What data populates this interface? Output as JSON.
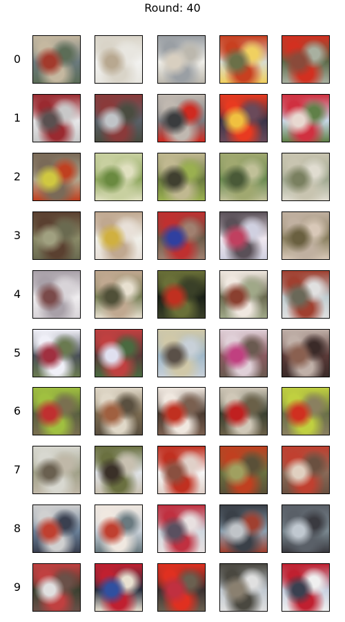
{
  "title": "Round: 40",
  "rows": [
    {
      "label": "0",
      "images": [
        [
          "#6b7a7e",
          "#c5b8a0",
          "#a33a2c",
          "#5c6d57"
        ],
        [
          "#f2f2f0",
          "#d9d4c8",
          "#b8a890",
          "#e8e6e0"
        ],
        [
          "#f0efea",
          "#9a9fa4",
          "#d8cfc0",
          "#bcb8ae"
        ],
        [
          "#d8dcd2",
          "#c84020",
          "#6b7048",
          "#f0d060"
        ],
        [
          "#5d6a4a",
          "#d23020",
          "#8a4a3a",
          "#a8b0a0"
        ]
      ]
    },
    {
      "label": "1",
      "images": [
        [
          "#e8e8ea",
          "#9a2a30",
          "#5a5050",
          "#c8c8c8"
        ],
        [
          "#5a6068",
          "#8a3a3a",
          "#c0c4c8",
          "#4a4c40"
        ],
        [
          "#7a7c80",
          "#c0b8b0",
          "#3a3c3e",
          "#d02a20"
        ],
        [
          "#3a3448",
          "#e83a20",
          "#f0c040",
          "#6a4a5a"
        ],
        [
          "#c8d8e8",
          "#d03040",
          "#e8d8d0",
          "#608048"
        ]
      ]
    },
    {
      "label": "2",
      "images": [
        [
          "#b0a890",
          "#7a6a58",
          "#d0c840",
          "#c04020"
        ],
        [
          "#90a860",
          "#c8d0a0",
          "#6a8a40",
          "#e0e0c0"
        ],
        [
          "#6a7a40",
          "#c0b890",
          "#404030",
          "#9ab050"
        ],
        [
          "#6a8a50",
          "#a0a870",
          "#4a5a38",
          "#c0c098"
        ],
        [
          "#a0a890",
          "#c8c4b0",
          "#7a8060",
          "#e0dcd0"
        ]
      ]
    },
    {
      "label": "3",
      "images": [
        [
          "#8a8a68",
          "#5a4030",
          "#a0a080",
          "#6a6a50"
        ],
        [
          "#f0f0ea",
          "#c0a890",
          "#d0b040",
          "#e8e0d8"
        ],
        [
          "#6a5a48",
          "#c03030",
          "#3040a0",
          "#a08070"
        ],
        [
          "#f0e8f0",
          "#5a5058",
          "#c04060",
          "#d0d0e0"
        ],
        [
          "#8a8060",
          "#c0b0a0",
          "#6a6040",
          "#d8c8b8"
        ]
      ]
    },
    {
      "label": "4",
      "images": [
        [
          "#f0eef0",
          "#a8a0a8",
          "#7a4a4a",
          "#d8d4d8"
        ],
        [
          "#7a8058",
          "#c0a890",
          "#505038",
          "#e8e0d0"
        ],
        [
          "#1a2018",
          "#6a7038",
          "#c03020",
          "#3a4028"
        ],
        [
          "#6a6a50",
          "#f0e8e0",
          "#8a4030",
          "#a0a888"
        ],
        [
          "#c0ccd0",
          "#a04030",
          "#6a6858",
          "#e0e0e0"
        ]
      ]
    },
    {
      "label": "5",
      "images": [
        [
          "#4a5058",
          "#f0f0f8",
          "#a03040",
          "#6a7a50"
        ],
        [
          "#5a3a38",
          "#c04040",
          "#e0e0f0",
          "#4a6a40"
        ],
        [
          "#a0b8c8",
          "#d0c8a8",
          "#5a5048",
          "#c8d0d8"
        ],
        [
          "#8a5a60",
          "#e0d0d8",
          "#c04080",
          "#6a5a50"
        ],
        [
          "#5a3a38",
          "#c0b0a8",
          "#8a6050",
          "#3a2a28"
        ]
      ]
    },
    {
      "label": "6",
      "images": [
        [
          "#5a6040",
          "#a0c040",
          "#c03030",
          "#7a7050"
        ],
        [
          "#7a6a50",
          "#e0d8c8",
          "#a06040",
          "#5a5040"
        ],
        [
          "#4a3a30",
          "#f0e8e0",
          "#c03020",
          "#7a6050"
        ],
        [
          "#3a4030",
          "#d0c8b8",
          "#c02020",
          "#6a6048"
        ],
        [
          "#6a7048",
          "#c0d040",
          "#d03020",
          "#8a8060"
        ]
      ]
    },
    {
      "label": "7",
      "images": [
        [
          "#a0a088",
          "#d8d8d0",
          "#6a6050",
          "#c0b8a8"
        ],
        [
          "#e0e4e8",
          "#6a7040",
          "#3a3028",
          "#c8c0b0"
        ],
        [
          "#f8f8f8",
          "#c03020",
          "#8a5040",
          "#e0d0c8"
        ],
        [
          "#6a7040",
          "#c04020",
          "#a0a060",
          "#5a5038"
        ],
        [
          "#8a6a58",
          "#c04030",
          "#e0d0c0",
          "#6a5040"
        ]
      ]
    },
    {
      "label": "8",
      "images": [
        [
          "#6a8098",
          "#d0d0d0",
          "#c04030",
          "#3a4050"
        ],
        [
          "#c8d0d8",
          "#f0e8e0",
          "#c04030",
          "#6a7a80"
        ],
        [
          "#d0d8e0",
          "#c03040",
          "#5a5060",
          "#e8e0e0"
        ],
        [
          "#8aa0b0",
          "#3a4048",
          "#c0c4c8",
          "#a04030"
        ],
        [
          "#7a8890",
          "#5a6068",
          "#c0c8d0",
          "#3a3a40"
        ]
      ]
    },
    {
      "label": "9",
      "images": [
        [
          "#3a4030",
          "#c04040",
          "#e0e0e0",
          "#6a5048"
        ],
        [
          "#2a3040",
          "#c02030",
          "#3050a0",
          "#e8e0d0"
        ],
        [
          "#3a3030",
          "#e03020",
          "#c03040",
          "#6a6050"
        ],
        [
          "#c0c8d0",
          "#4a4840",
          "#8a8070",
          "#e0e0e0"
        ],
        [
          "#c8d0e0",
          "#c02030",
          "#3a4050",
          "#f0f0f0"
        ]
      ]
    }
  ]
}
